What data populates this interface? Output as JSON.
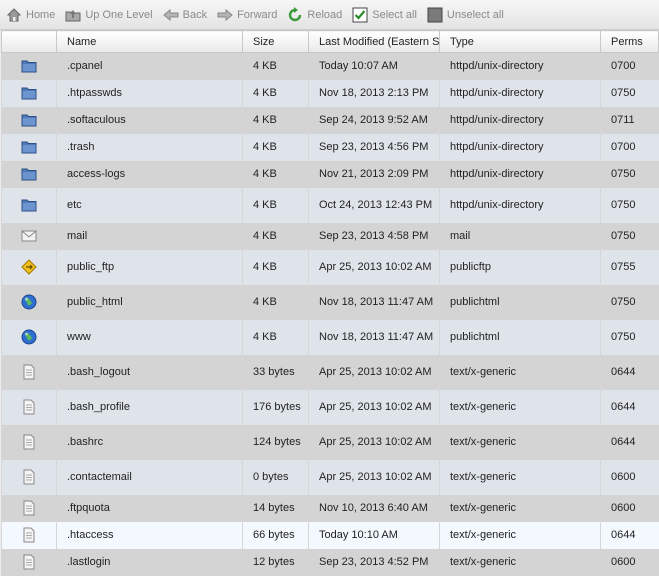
{
  "toolbar": {
    "home": "Home",
    "up": "Up One Level",
    "back": "Back",
    "forward": "Forward",
    "reload": "Reload",
    "select_all": "Select all",
    "unselect_all": "Unselect all"
  },
  "columns": {
    "name": "Name",
    "size": "Size",
    "modified": "Last Modified (Eastern St",
    "type": "Type",
    "perms": "Perms"
  },
  "files": [
    {
      "name": ".cpanel",
      "size": "4 KB",
      "modified": "Today 10:07 AM",
      "type": "httpd/unix-directory",
      "perms": "0700",
      "icon": "folder-icon"
    },
    {
      "name": ".htpasswds",
      "size": "4 KB",
      "modified": "Nov 18, 2013 2:13 PM",
      "type": "httpd/unix-directory",
      "perms": "0750",
      "icon": "folder-icon"
    },
    {
      "name": ".softaculous",
      "size": "4 KB",
      "modified": "Sep 24, 2013 9:52 AM",
      "type": "httpd/unix-directory",
      "perms": "0711",
      "icon": "folder-icon"
    },
    {
      "name": ".trash",
      "size": "4 KB",
      "modified": "Sep 23, 2013 4:56 PM",
      "type": "httpd/unix-directory",
      "perms": "0700",
      "icon": "folder-icon"
    },
    {
      "name": "access-logs",
      "size": "4 KB",
      "modified": "Nov 21, 2013 2:09 PM",
      "type": "httpd/unix-directory",
      "perms": "0750",
      "icon": "folder-icon"
    },
    {
      "name": "etc",
      "size": "4 KB",
      "modified": "Oct 24, 2013 12:43 PM",
      "type": "httpd/unix-directory",
      "perms": "0750",
      "icon": "folder-icon"
    },
    {
      "name": "mail",
      "size": "4 KB",
      "modified": "Sep 23, 2013 4:58 PM",
      "type": "mail",
      "perms": "0750",
      "icon": "mail-icon"
    },
    {
      "name": "public_ftp",
      "size": "4 KB",
      "modified": "Apr 25, 2013 10:02 AM",
      "type": "publicftp",
      "perms": "0755",
      "icon": "ftp-icon"
    },
    {
      "name": "public_html",
      "size": "4 KB",
      "modified": "Nov 18, 2013 11:47 AM",
      "type": "publichtml",
      "perms": "0750",
      "icon": "globe-icon"
    },
    {
      "name": "www",
      "size": "4 KB",
      "modified": "Nov 18, 2013 11:47 AM",
      "type": "publichtml",
      "perms": "0750",
      "icon": "globe-icon"
    },
    {
      "name": ".bash_logout",
      "size": "33 bytes",
      "modified": "Apr 25, 2013 10:02 AM",
      "type": "text/x-generic",
      "perms": "0644",
      "icon": "file-icon"
    },
    {
      "name": ".bash_profile",
      "size": "176 bytes",
      "modified": "Apr 25, 2013 10:02 AM",
      "type": "text/x-generic",
      "perms": "0644",
      "icon": "file-icon"
    },
    {
      "name": ".bashrc",
      "size": "124 bytes",
      "modified": "Apr 25, 2013 10:02 AM",
      "type": "text/x-generic",
      "perms": "0644",
      "icon": "file-icon"
    },
    {
      "name": ".contactemail",
      "size": "0 bytes",
      "modified": "Apr 25, 2013 10:02 AM",
      "type": "text/x-generic",
      "perms": "0600",
      "icon": "file-icon"
    },
    {
      "name": ".ftpquota",
      "size": "14 bytes",
      "modified": "Nov 10, 2013 6:40 AM",
      "type": "text/x-generic",
      "perms": "0600",
      "icon": "file-icon"
    },
    {
      "name": ".htaccess",
      "size": "66 bytes",
      "modified": "Today 10:10 AM",
      "type": "text/x-generic",
      "perms": "0644",
      "icon": "file-icon",
      "selected": true
    },
    {
      "name": ".lastlogin",
      "size": "12 bytes",
      "modified": "Sep 23, 2013 4:52 PM",
      "type": "text/x-generic",
      "perms": "0600",
      "icon": "file-icon"
    }
  ]
}
